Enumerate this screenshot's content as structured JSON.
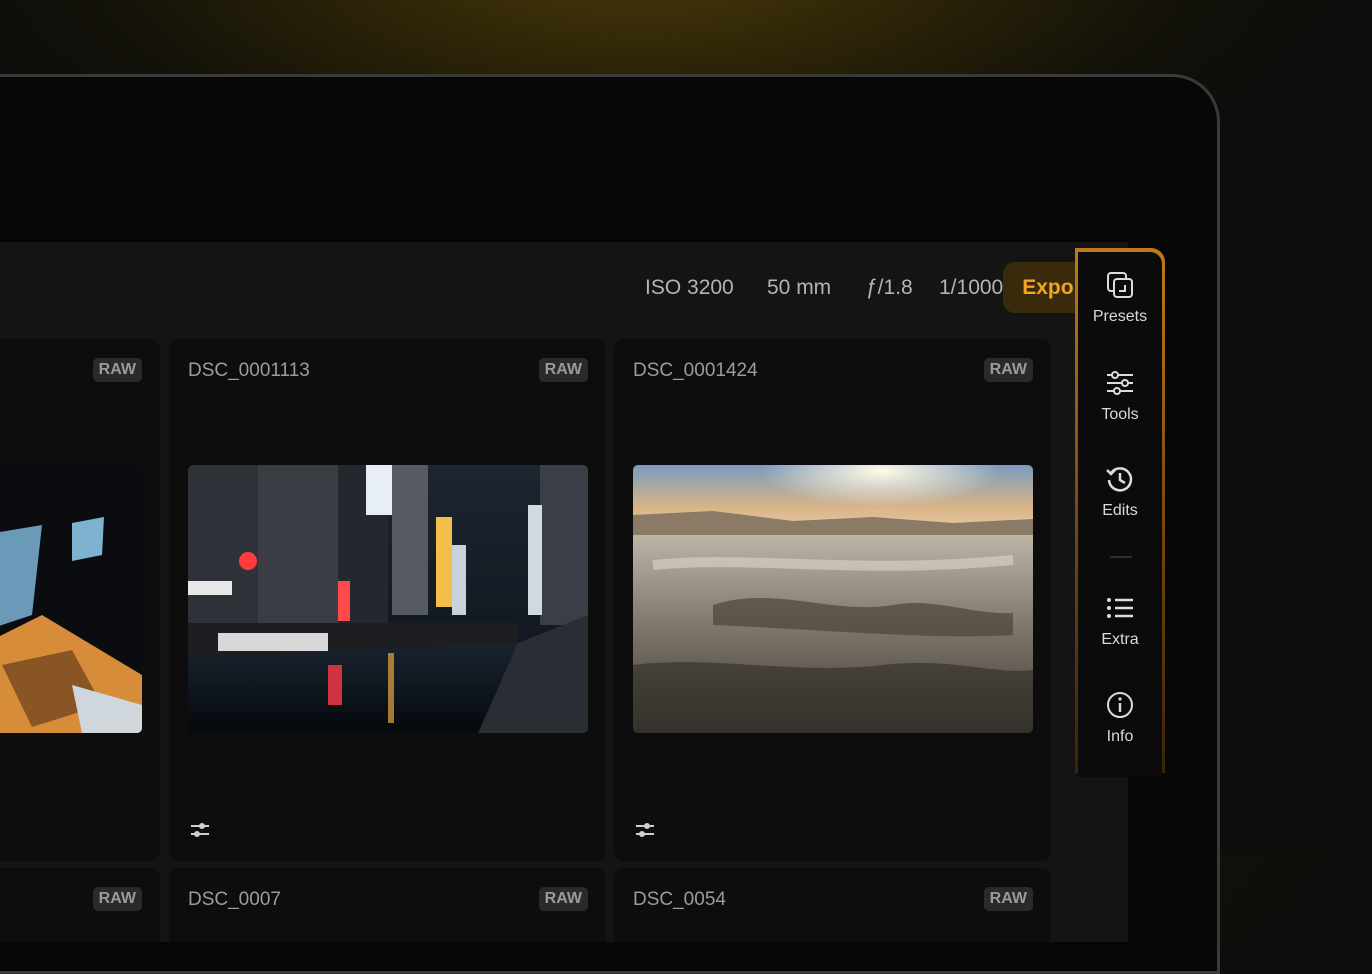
{
  "meta": {
    "iso": "ISO 3200",
    "focal": "50 mm",
    "aperture": "ƒ/1.8",
    "shutter": "1/1000 s"
  },
  "export_label": "Export",
  "cards": [
    {
      "name": "",
      "badge": "RAW"
    },
    {
      "name": "DSC_0001113",
      "badge": "RAW"
    },
    {
      "name": "DSC_0001424",
      "badge": "RAW"
    },
    {
      "name": "",
      "badge": "RAW"
    },
    {
      "name": "DSC_0007",
      "badge": "RAW"
    },
    {
      "name": "DSC_0054",
      "badge": "RAW"
    }
  ],
  "sidebar": [
    {
      "label": "Presets",
      "icon": "presets-icon"
    },
    {
      "label": "Tools",
      "icon": "sliders-icon"
    },
    {
      "label": "Edits",
      "icon": "history-icon"
    },
    {
      "label": "Extra",
      "icon": "list-icon"
    },
    {
      "label": "Info",
      "icon": "info-icon"
    }
  ],
  "colors": {
    "accent": "#f3a51f",
    "export_bg": "#3a2a0c"
  }
}
